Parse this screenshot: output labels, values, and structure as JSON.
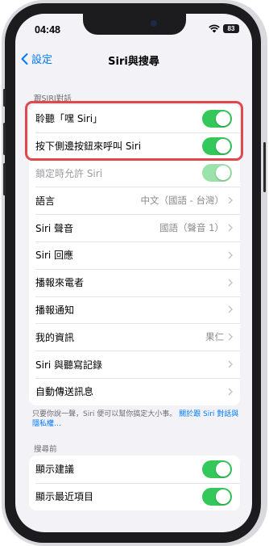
{
  "status": {
    "time": "04:48",
    "battery": "83"
  },
  "nav": {
    "back_label": "設定",
    "title": "Siri與搜尋"
  },
  "siri_section": {
    "header": "跟SIRI對話",
    "rows": [
      {
        "label": "聆聽「嘿 Siri」",
        "toggle": true
      },
      {
        "label": "按下側邊按鈕來呼叫 Siri",
        "toggle": true
      },
      {
        "label": "鎖定時允許 Siri",
        "toggle": true,
        "disabled": true
      },
      {
        "label": "語言",
        "value": "中文（國語 - 台灣）"
      },
      {
        "label": "Siri 聲音",
        "value": "國語（聲音 1）"
      },
      {
        "label": "Siri 回應"
      },
      {
        "label": "播報來電者"
      },
      {
        "label": "播報通知"
      },
      {
        "label": "我的資訊",
        "value": "果仁"
      },
      {
        "label": "Siri 與聽寫記錄"
      },
      {
        "label": "自動傳送訊息"
      }
    ],
    "footer_text": "只要你說一聲，Siri 便可以幫你搞定大小事。",
    "footer_link": "關於跟 Siri 對話與隱私權…"
  },
  "search_section": {
    "header": "搜尋前",
    "rows": [
      {
        "label": "顯示建議",
        "toggle": true
      },
      {
        "label": "顯示最近項目",
        "toggle": true
      }
    ]
  },
  "colors": {
    "accent": "#007aff",
    "toggle_on": "#34c759",
    "highlight": "#e0484d"
  },
  "icons": {
    "back": "chevron-left-icon",
    "row_nav": "chevron-right-icon",
    "wifi": "wifi-icon"
  }
}
